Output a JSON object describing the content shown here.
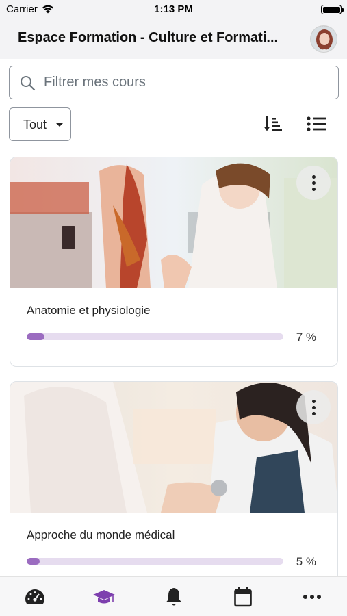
{
  "status_bar": {
    "carrier": "Carrier",
    "time": "1:13 PM"
  },
  "header": {
    "title": "Espace Formation - Culture et Formati..."
  },
  "search": {
    "placeholder": "Filtrer mes cours"
  },
  "filter": {
    "selected": "Tout"
  },
  "courses": [
    {
      "title": "Anatomie et physiologie",
      "progress_percent": 7,
      "progress_text": "7 %"
    },
    {
      "title": "Approche du monde médical",
      "progress_percent": 5,
      "progress_text": "5 %"
    }
  ],
  "tabbar": {
    "items": [
      "dashboard-icon",
      "courses-icon",
      "notifications-icon",
      "calendar-icon",
      "more-icon"
    ],
    "active": "courses-icon"
  },
  "colors": {
    "accent": "#7d3fae",
    "progress_fill": "#9b6cc0",
    "progress_track": "#e6dcef"
  }
}
